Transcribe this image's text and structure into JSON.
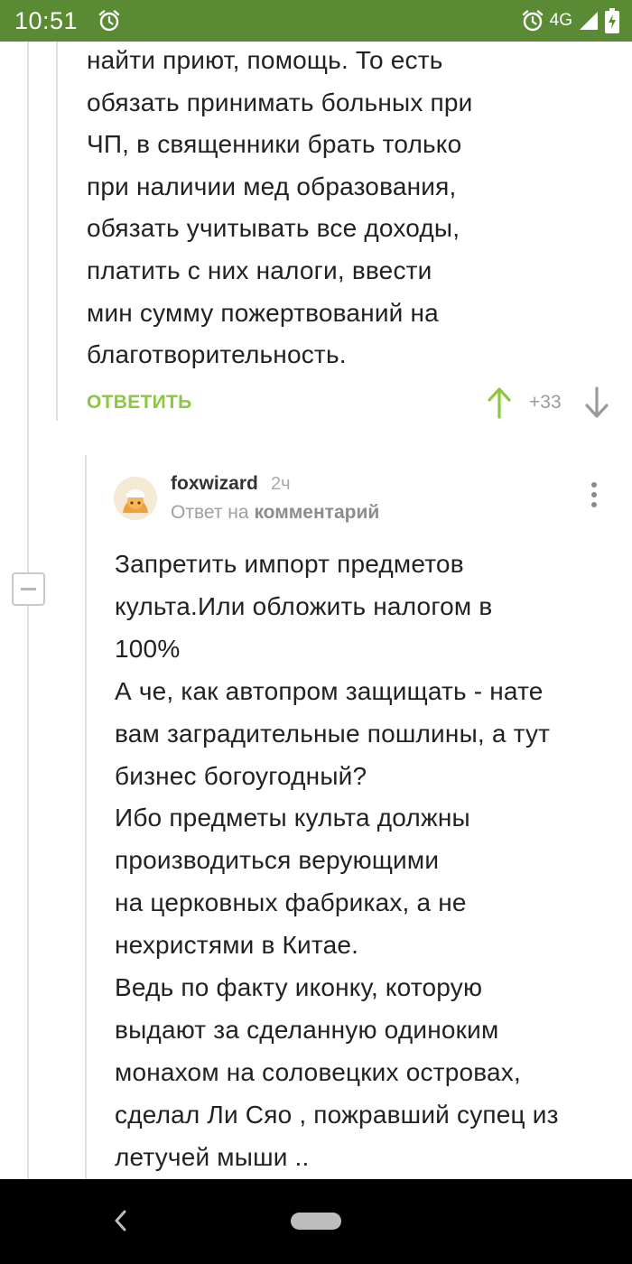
{
  "status_bar": {
    "time": "10:51",
    "network": "4G",
    "icons": [
      "alarm-icon",
      "alarm-icon",
      "signal-icon",
      "battery-icon"
    ],
    "background_color": "#5a8a34"
  },
  "parent_comment": {
    "lines": [
      "найти приют, помощь. То есть",
      "обязать принимать больных при",
      "ЧП, в священники брать только",
      "при наличии мед образования,",
      "обязать учитывать все доходы,",
      "платить с них налоги, ввести",
      "мин сумму пожертвований на",
      "благотворительность."
    ],
    "reply_label": "ОТВЕТИТЬ",
    "rating": "+33",
    "accent_color": "#8dc63f"
  },
  "reply_comment": {
    "author": "foxwizard",
    "time": "2ч",
    "reply_prefix": "Ответ на",
    "reply_target": "комментарий",
    "lines": [
      "Запретить импорт предметов",
      "культа.Или обложить налогом в",
      "100%",
      "А че, как автопром защищать - нате",
      "вам заградительные пошлины, а тут",
      "бизнес богоугодный?",
      "Ибо предметы культа должны",
      "производиться верующими",
      "на церковных фабриках, а не",
      "нехристями в Китае.",
      "Ведь по факту иконку, которую",
      "выдают за сделанную одиноким",
      "монахом на соловецких островах,",
      "сделал Ли Сяо , пожравший супец из",
      "летучей мыши .."
    ]
  },
  "nav_bar": {
    "icons": [
      "back-icon",
      "home-pill-icon"
    ]
  }
}
